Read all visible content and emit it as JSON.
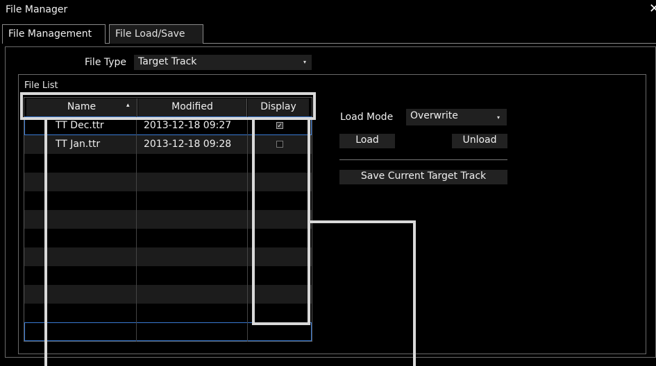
{
  "window": {
    "title": "File Manager",
    "close_glyph": "✕"
  },
  "tabs": [
    {
      "label": "File Management"
    },
    {
      "label": "File Load/Save"
    }
  ],
  "file_type": {
    "label": "File Type",
    "value": "Target Track",
    "arrow": "▾"
  },
  "file_list": {
    "label": "File List",
    "columns": {
      "name": "Name",
      "sort_glyph": "▴",
      "modified": "Modified",
      "display": "Display"
    },
    "rows": [
      {
        "name": "TT Dec.ttr",
        "modified": "2013-12-18 09:27",
        "display": true
      },
      {
        "name": "TT Jan.ttr",
        "modified": "2013-12-18 09:28",
        "display": false
      }
    ]
  },
  "load_mode": {
    "label": "Load Mode",
    "value": "Overwrite",
    "arrow": "▾"
  },
  "buttons": {
    "load": "Load",
    "unload": "Unload",
    "save_current": "Save Current Target Track"
  }
}
